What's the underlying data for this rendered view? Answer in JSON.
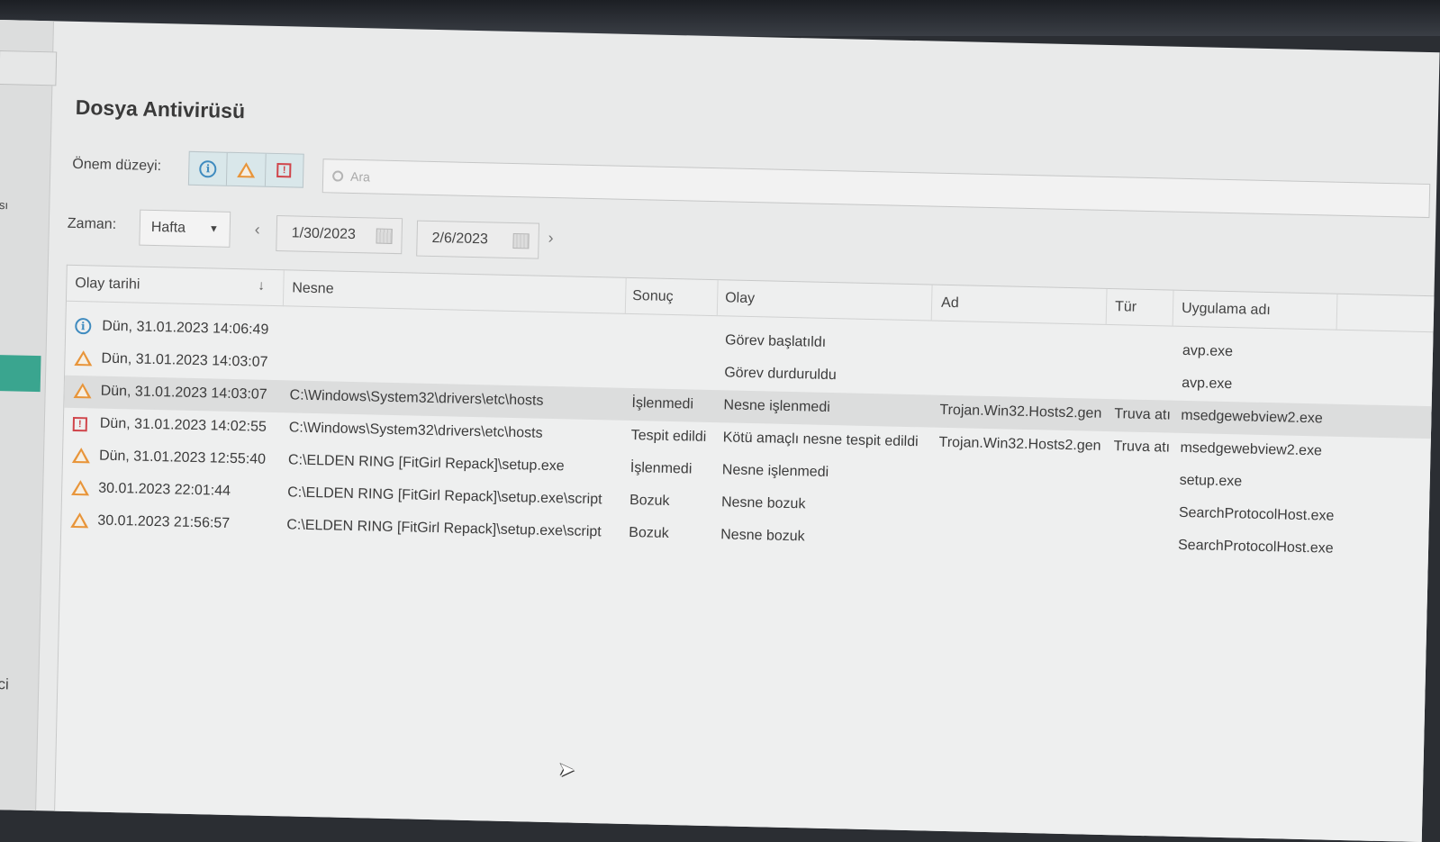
{
  "page": {
    "title": "Dosya Antivirüsü",
    "sidebar_text_1": "ısı",
    "sidebar_text_2": "yici"
  },
  "filters": {
    "severity_label": "Önem düzeyi:",
    "severity_buttons": [
      "info-icon",
      "warning-icon",
      "error-icon"
    ],
    "search_placeholder": "Ara",
    "time_label": "Zaman:",
    "period": "Hafta",
    "date_from": "1/30/2023",
    "date_to": "2/6/2023"
  },
  "table": {
    "columns": [
      "Olay tarihi",
      "Nesne",
      "Sonuç",
      "Olay",
      "Ad",
      "Tür",
      "Uygulama adı"
    ],
    "rows": [
      {
        "icon": "info-icon",
        "date": "Dün, 31.01.2023 14:06:49",
        "object": "",
        "result": "",
        "event": "Görev başlatıldı",
        "name": "",
        "type": "",
        "app": "avp.exe"
      },
      {
        "icon": "warning-icon",
        "date": "Dün, 31.01.2023 14:03:07",
        "object": "",
        "result": "",
        "event": "Görev durduruldu",
        "name": "",
        "type": "",
        "app": "avp.exe"
      },
      {
        "icon": "warning-icon",
        "date": "Dün, 31.01.2023 14:03:07",
        "object": "C:\\Windows\\System32\\drivers\\etc\\hosts",
        "result": "İşlenmedi",
        "event": "Nesne işlenmedi",
        "name": "Trojan.Win32.Hosts2.gen",
        "type": "Truva atı",
        "app": "msedgewebview2.exe"
      },
      {
        "icon": "error-icon",
        "date": "Dün, 31.01.2023 14:02:55",
        "object": "C:\\Windows\\System32\\drivers\\etc\\hosts",
        "result": "Tespit edildi",
        "event": "Kötü amaçlı nesne tespit edildi",
        "name": "Trojan.Win32.Hosts2.gen",
        "type": "Truva atı",
        "app": "msedgewebview2.exe"
      },
      {
        "icon": "warning-icon",
        "date": "Dün, 31.01.2023 12:55:40",
        "object": "C:\\ELDEN RING [FitGirl Repack]\\setup.exe",
        "result": "İşlenmedi",
        "event": "Nesne işlenmedi",
        "name": "",
        "type": "",
        "app": "setup.exe"
      },
      {
        "icon": "warning-icon",
        "date": "30.01.2023 22:01:44",
        "object": "C:\\ELDEN RING [FitGirl Repack]\\setup.exe\\script",
        "result": "Bozuk",
        "event": "Nesne bozuk",
        "name": "",
        "type": "",
        "app": "SearchProtocolHost.exe"
      },
      {
        "icon": "warning-icon",
        "date": "30.01.2023 21:56:57",
        "object": "C:\\ELDEN RING [FitGirl Repack]\\setup.exe\\script",
        "result": "Bozuk",
        "event": "Nesne bozuk",
        "name": "",
        "type": "",
        "app": "SearchProtocolHost.exe"
      }
    ]
  },
  "colors": {
    "accent_selected": "#3aa58f",
    "info": "#3f8bbf",
    "warning": "#e8953a",
    "error": "#d0454b"
  }
}
